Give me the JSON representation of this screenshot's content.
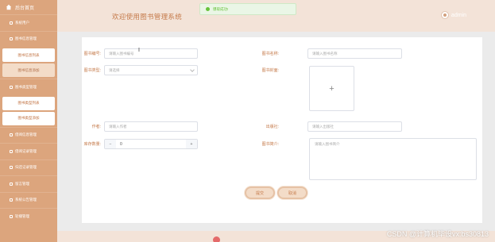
{
  "sidebar": {
    "brand": "后台首页",
    "items": [
      {
        "label": "系统用户",
        "type": "group"
      },
      {
        "label": "图书信息管理",
        "type": "group"
      },
      {
        "label": "图书信息列表",
        "type": "sub"
      },
      {
        "label": "图书信息添加",
        "type": "sub-active"
      },
      {
        "label": "图书类型管理",
        "type": "group"
      },
      {
        "label": "图书类型列表",
        "type": "sub"
      },
      {
        "label": "图书类型添加",
        "type": "sub"
      },
      {
        "label": "借阅信息管理",
        "type": "group"
      },
      {
        "label": "借阅记录管理",
        "type": "group"
      },
      {
        "label": "归还记录管理",
        "type": "group"
      },
      {
        "label": "留言管理",
        "type": "group"
      },
      {
        "label": "系统公告管理",
        "type": "group"
      },
      {
        "label": "轮播管理",
        "type": "group"
      }
    ]
  },
  "header": {
    "title": "欢迎使用图书管理系统",
    "user": "admin"
  },
  "toast": {
    "message": "爆取成功!"
  },
  "form": {
    "book_no_label": "图书编号:",
    "book_no_placeholder": "请输入图书编号",
    "book_name_label": "图书名称:",
    "book_name_placeholder": "请输入图书名称",
    "book_type_label": "图书类型:",
    "book_type_placeholder": "请选择",
    "cover_label": "图书封面:",
    "cover_plus": "+",
    "author_label": "作者:",
    "author_placeholder": "请输入作者",
    "publisher_label": "出版社:",
    "publisher_placeholder": "请输入出版社",
    "stock_label": "库存数量:",
    "stock_value": "0",
    "intro_label": "图书简介:",
    "intro_placeholder": "请输入图书简介",
    "submit_label": "提交",
    "cancel_label": "取消"
  },
  "watermark": "CSDN @计算机毕设vx:bs30813",
  "colors": {
    "sidebar": "#dca57d",
    "accent": "#c57a4a",
    "header": "#f3e3d8"
  }
}
